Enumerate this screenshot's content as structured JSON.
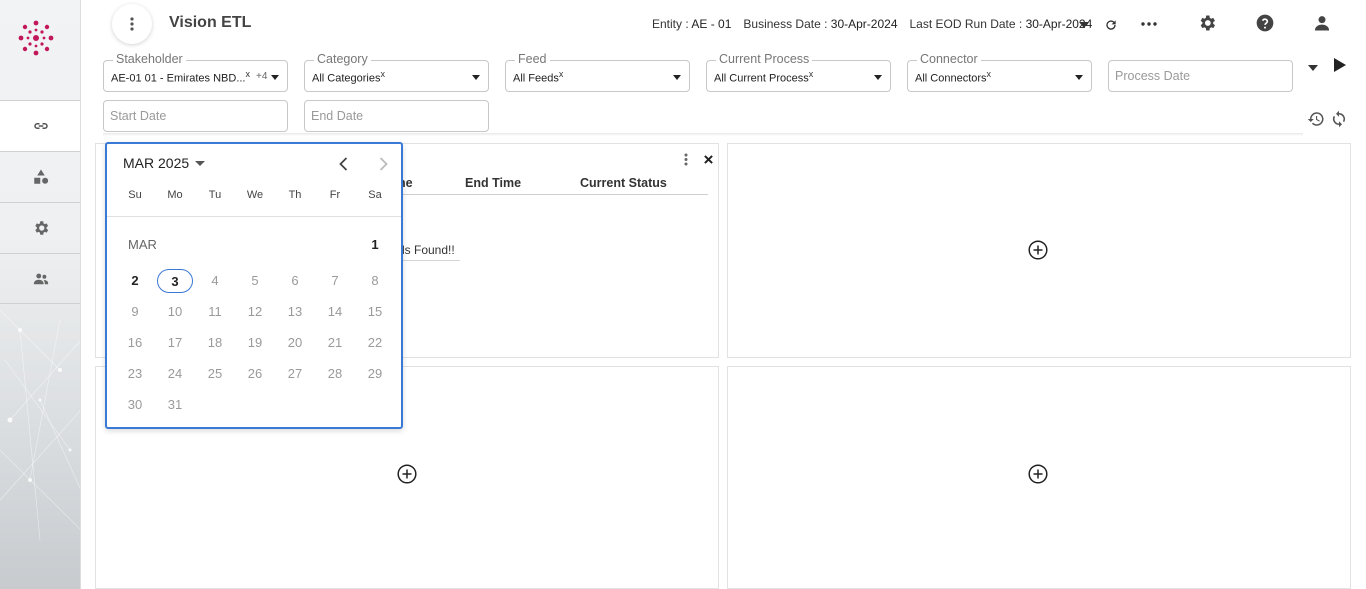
{
  "app": {
    "title": "Vision ETL"
  },
  "header": {
    "entity_label": "Entity :",
    "entity_value": "AE - 01",
    "business_date_label": "Business Date :",
    "business_date_value": "30-Apr-2024",
    "last_eod_label": "Last EOD Run Date :",
    "last_eod_value": "30-Apr-2024"
  },
  "filters": {
    "stakeholder": {
      "label": "Stakeholder",
      "value": "AE-01 01 - Emirates NBD...",
      "clear": "x",
      "extra": "+4"
    },
    "category": {
      "label": "Category",
      "value": "All Categories",
      "clear": "x"
    },
    "feed": {
      "label": "Feed",
      "value": "All Feeds",
      "clear": "x"
    },
    "current_process": {
      "label": "Current Process",
      "value": "All Current Process",
      "clear": "x"
    },
    "connector": {
      "label": "Connector",
      "value": "All Connectors",
      "clear": "x"
    },
    "process_date": {
      "placeholder": "Process Date"
    },
    "start_date": {
      "placeholder": "Start Date"
    },
    "end_date": {
      "placeholder": "End Date"
    }
  },
  "widget1": {
    "columns": [
      "ne",
      "End Time",
      "Current Status"
    ],
    "empty_message": "ds Found!!"
  },
  "calendar": {
    "title": "MAR 2025",
    "month_label": "MAR",
    "weekdays": [
      "Su",
      "Mo",
      "Tu",
      "We",
      "Th",
      "Fr",
      "Sa"
    ],
    "today": 3,
    "enabled_days": [
      1,
      2,
      3
    ],
    "days_in_month": 31,
    "first_weekday": 6
  },
  "icons": {
    "sidebar": [
      "link-icon",
      "shapes-icon",
      "settings-icon",
      "users-icon"
    ],
    "header": [
      "refresh-icon",
      "more-horizontal-icon",
      "settings-icon",
      "help-icon",
      "user-icon"
    ]
  },
  "colors": {
    "accent": "#3b79d6",
    "logo": "#c2185b"
  }
}
